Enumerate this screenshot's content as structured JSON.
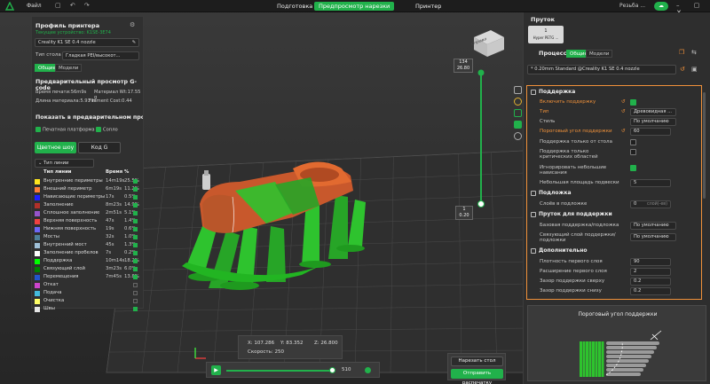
{
  "colors": {
    "accent": "#21b14b",
    "highlight": "#f0913a",
    "model": "#c8582c",
    "support": "#2ec32e"
  },
  "titlebar": {
    "file_menu": "Файл",
    "tabs": [
      "Подготовка",
      "Предпросмотр нарезки",
      "Принтер"
    ],
    "active_tab": 1,
    "user": "Резьба ..."
  },
  "left": {
    "printer_profile_title": "Профиль принтера",
    "current_device": "Текущее устройство: K1SE-3E74",
    "printer_name": "Creality K1 SE 0.4 nozzle",
    "bed_type_label": "Тип стола",
    "bed_type_value": "Гладкая PEI/высокот...",
    "tab_general": "Общие",
    "tab_models": "Модели",
    "gcode_preview_title": "Предварительный просмотр G-code",
    "print_time": "Время печати:56m9s",
    "material_weight": "Материал Wt:17.55 g",
    "material_length": "Длина материала:5.93 m",
    "filament_cost": "Filament Cost:0.44",
    "show_in_preview": "Показать в предварительном просмо",
    "show_bed": "Печатная платформа",
    "show_nozzle": "Сопло",
    "color_scheme_btn": "Цветное шоу",
    "gcode_btn": "Код G",
    "line_type_select": "Тип линии",
    "col_line_type": "Тип линии",
    "col_time": "Время",
    "col_percent": "%",
    "legend": [
      {
        "name": "Внутренние периметры",
        "time": "14m19s",
        "pct": "25.5%",
        "color": "#ffe61e",
        "on": true
      },
      {
        "name": "Внешний периметр",
        "time": "6m19s",
        "pct": "11.2%",
        "color": "#ff7d38",
        "on": true
      },
      {
        "name": "Нависающие периметры",
        "time": "17s",
        "pct": "0.5%",
        "color": "#1f1fff",
        "on": true
      },
      {
        "name": "Заполнение",
        "time": "8m23s",
        "pct": "14.9%",
        "color": "#b03029",
        "on": true
      },
      {
        "name": "Сплошное заполнение",
        "time": "2m51s",
        "pct": "5.1%",
        "color": "#9654cc",
        "on": true
      },
      {
        "name": "Верхняя поверхность",
        "time": "47s",
        "pct": "1.4%",
        "color": "#f04040",
        "on": true
      },
      {
        "name": "Нижняя поверхность",
        "time": "19s",
        "pct": "0.6%",
        "color": "#6c66f6",
        "on": true
      },
      {
        "name": "Мосты",
        "time": "32s",
        "pct": "1.0%",
        "color": "#4d8099",
        "on": true
      },
      {
        "name": "Внутренний мост",
        "time": "45s",
        "pct": "1.3%",
        "color": "#a0c1d8",
        "on": true
      },
      {
        "name": "Заполнение пробелов",
        "time": "7s",
        "pct": "0.2%",
        "color": "#ffffff",
        "on": true
      },
      {
        "name": "Поддержка",
        "time": "10m14s",
        "pct": "18.2%",
        "color": "#00ff00",
        "on": true
      },
      {
        "name": "Связующий слой",
        "time": "3m23s",
        "pct": "6.0%",
        "color": "#008000",
        "on": true
      },
      {
        "name": "Перемещения",
        "time": "7m45s",
        "pct": "13.8%",
        "color": "#2255cc",
        "on": true
      },
      {
        "name": "Откат",
        "time": "",
        "pct": "",
        "color": "#cc44cc",
        "on": false
      },
      {
        "name": "Подача",
        "time": "",
        "pct": "",
        "color": "#44bbdd",
        "on": false
      },
      {
        "name": "Очистка",
        "time": "",
        "pct": "",
        "color": "#ffff66",
        "on": false
      },
      {
        "name": "Швы",
        "time": "",
        "pct": "",
        "color": "#e6e6e6",
        "on": true
      }
    ]
  },
  "viewport": {
    "view_cube": "Справа",
    "layer_top": "134",
    "layer_top_z": "26.80",
    "layer_bottom": "1",
    "layer_bottom_z": "0.20",
    "coord_x": "X: 107.286",
    "coord_y": "Y: 83.352",
    "coord_z": "Z: 26.800",
    "speed": "Скорость: 250",
    "slider_value": "510",
    "slice_plate_btn": "Нарезать стол",
    "send_print_btn": "Отправить распечатку"
  },
  "right": {
    "filament_title": "Пруток",
    "filament_slot": "1",
    "filament_name": "Hyper PETG ...",
    "process_title": "Процесс",
    "process_tab_general": "Общие",
    "process_tab_models": "Модели",
    "process_profile": "* 0.20mm  Standard @Creality K1 SE 0.4 nozzle",
    "sections": {
      "support": "Поддержка",
      "raft": "Подложка",
      "support_filament": "Пруток для поддержки",
      "advanced": "Дополнительно"
    },
    "rows": {
      "enable_support": "Включить поддержку",
      "type": "Тип",
      "type_value": "Древовидная ...",
      "style": "Стиль",
      "style_value": "По умолчанию",
      "threshold_angle": "Пороговый угол поддержки",
      "threshold_value": "60",
      "on_build_plate": "Поддержка только от стола",
      "critical_regions": "Поддержка только критических областей",
      "ignore_small": "Игнорировать небольшие нависания",
      "floating_area": "Небольшая площадь подвески",
      "floating_value": "5",
      "raft_layers": "Слоёв в подложке",
      "raft_value": "0",
      "raft_unit": "слой(-ев)",
      "base_filament": "Базовая поддержка/подложка",
      "base_value": "По умолчанию",
      "interface_filament": "Связующий слой поддержки/подложки",
      "interface_value": "По умолчанию",
      "first_layer_density": "Плотность первого слоя",
      "first_layer_density_value": "90",
      "first_layer_expansion": "Расширение первого слоя",
      "first_layer_expansion_value": "2",
      "top_z": "Зазор поддержки сверху",
      "top_z_value": "0.2",
      "bottom_z": "Зазор поддержки снизу",
      "bottom_z_value": "0.2"
    },
    "tooltip_title": "Пороговый угол поддержки"
  }
}
